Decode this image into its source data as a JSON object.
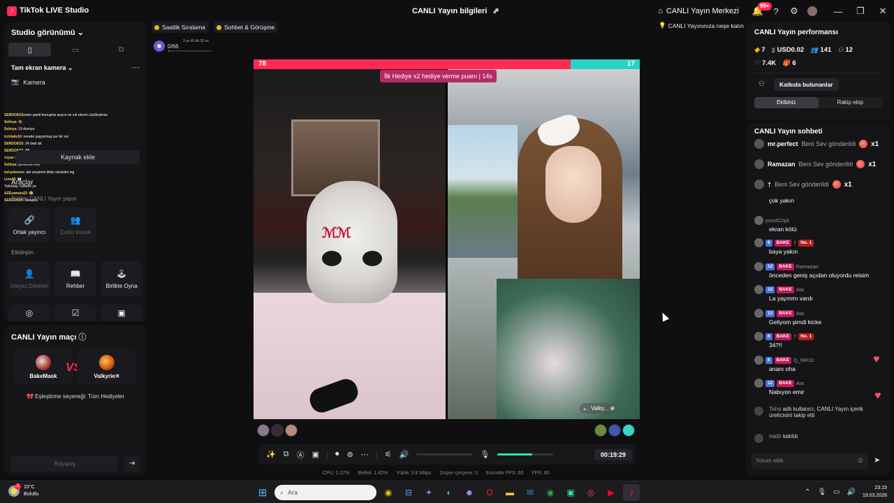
{
  "titlebar": {
    "app_name": "TikTok LIVE Studio",
    "center_title": "CANLI Yayın bilgileri",
    "merkezi": "CANLI Yayın Merkezi",
    "notif_badge": "99+",
    "icons": [
      "share-icon",
      "home-icon",
      "bell-icon",
      "help-icon",
      "gear-icon",
      "avatar"
    ]
  },
  "left": {
    "studio_view": "Studio görünümü",
    "layout_tabs": [
      "▯",
      "▭",
      "⧉"
    ],
    "fullscreen_camera": "Tam ekran kamera",
    "camera": "Kamera",
    "chat_overlay": [
      {
        "user": "SERDO6O5",
        "text": "senin şamti konuşma aracın ne cıtı ekrem cüsSkalmez"
      },
      {
        "user": "Selinya",
        "text": ": 🍓"
      },
      {
        "user": "Selinya",
        "text": ": 19 duvoyo"
      },
      {
        "user": "ircirkale16",
        "text": ": nerede yaşyormuş sor bir sor"
      },
      {
        "user": "SERDO6O5",
        "text": ": 24 dedi sik"
      },
      {
        "user": "SERDO6O5",
        "text": ": 👀"
      },
      {
        "user": "ruyao",
        "text": ": rir"
      },
      {
        "user": "Selinya",
        "text": ": gerekirse evet"
      },
      {
        "user": "twizydemon",
        "text": ": abi veryimmi iltilat cümleleri ing"
      },
      {
        "user": "Lined0",
        "text": ": 👀"
      },
      {
        "user": "",
        "text": "Yahuday i üzledik ya"
      },
      {
        "user": "AZEyamara22",
        "text": ": 😂"
      },
      {
        "user": "SERDO6O5",
        "text": ": basakta"
      }
    ],
    "add_source": "Kaynak ekle",
    "tools": "Araçlar",
    "live_together": "Birlikte CANLI Yayın yapın",
    "cohost": "Ortak yayıncı",
    "multi_guest": "Çoklu konuk",
    "interaction": "Etkileşim",
    "viewer_requests": "İzleyici Dilekleri",
    "guide": "Rehber",
    "play_together": "Birlikte Oyna",
    "match_title": "CANLI Yayın maçı",
    "player1": "BakeMask",
    "player2": "Valkyrie✕",
    "vs": "VS",
    "match_option": "🎀 Eşleştirme seçeneği: Tüm Hediyeler",
    "rematch": "Rövanş"
  },
  "center": {
    "chip1": "Saatlik Sıralama",
    "chip2": "Sohbet & Görüşme",
    "goal_count": "0/66",
    "goal_time": "3 sa 40 dk 35 sn",
    "goal_progress": 0.03,
    "fun_chip": "CANLI Yayınınıza neşe katın",
    "score_left": "78",
    "score_right": "17",
    "gift_banner": "İlk Hediye x2 hediye verme puanı | 14s",
    "guest_tag": "Valky...",
    "timer": "00:19:29",
    "mic_level": 0.62,
    "stats": {
      "cpu": "CPU:  2.27%",
      "mem": "Bellek:  1.82%",
      "upload": "Yükle:  3.8 Mbps",
      "dropped": "Düşen çerçeve:  0",
      "encoder": "Encoder FPS:  60",
      "fps": "FPS:  60"
    }
  },
  "right": {
    "perf_title": "CANLI Yayın performansı",
    "diamonds": "7",
    "usd": "USD0.02",
    "viewers": "141",
    "followers": "12",
    "likes": "7.4K",
    "gifts": "6",
    "contributors": "Katkıda bulunanlar",
    "tab_team": "Ekibiniz",
    "tab_rival": "Rakip ekip",
    "chat_title": "CANLI Yayın sohbeti",
    "gifts_list": [
      {
        "user": "mr.perfect",
        "action": "Beni Sev gönderildi",
        "count": "x1"
      },
      {
        "user": "Ramazan",
        "action": "Beni Sev gönderildi",
        "count": "x1"
      },
      {
        "user": "†",
        "action": "Beni Sev gönderildi",
        "count": "x1"
      }
    ],
    "messages": [
      {
        "meta": "",
        "text": "çok yakın"
      },
      {
        "meta": "yusuf12pk",
        "text": "ekran kötü"
      },
      {
        "meta": "†",
        "text": "baya yakın",
        "lvl": "6",
        "fan": "BAKE",
        "no": "No. 1"
      },
      {
        "meta": "Ramazan",
        "text": "önceden geniş açıdan oluyordu reisim",
        "lvl": "12",
        "fan": "BAKE"
      },
      {
        "meta": "Ata",
        "text": "La yayınmı vardı",
        "lvl": "12",
        "fan": "BAKE"
      },
      {
        "meta": "Ata",
        "text": "Geliyom şimdi kicke",
        "lvl": "12",
        "fan": "BAKE"
      },
      {
        "meta": "†",
        "text": "34?!!",
        "lvl": "6",
        "fan": "BAKE",
        "no": "No. 1"
      },
      {
        "meta": "Q_NR10",
        "text": "ananı oha",
        "lvl": "6",
        "fan": "BAKE"
      },
      {
        "meta": "Ata",
        "text": "Nabıyon emir",
        "lvl": "12",
        "fan": "BAKE"
      }
    ],
    "sys1_name": "Taha",
    "sys1_text": "adlı kullanıcı, CANLI Yayın içerik üreticisini takip etti",
    "sys2_name": "nadir",
    "sys2_text": "katıldı",
    "comment_placeholder": "Yorum ekle"
  },
  "taskbar": {
    "temp": "15°C",
    "weather": "Bulutlu",
    "weather_badge": "2",
    "search": "Ara",
    "time": "23:15",
    "date": "19.03.2026"
  }
}
